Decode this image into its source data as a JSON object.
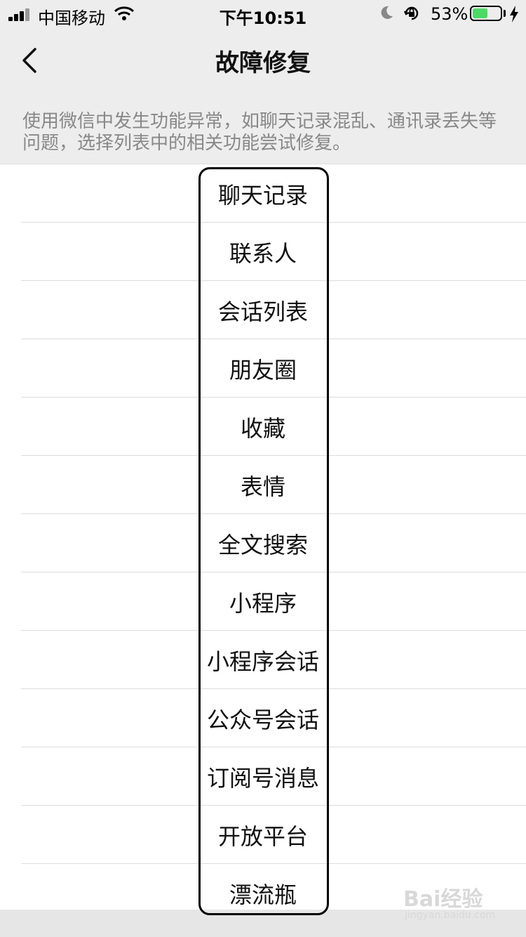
{
  "status_bar": {
    "carrier": "中国移动",
    "time": "下午10:51",
    "battery_percent": "53%",
    "battery_level": 0.53,
    "battery_color": "#4cd964"
  },
  "nav": {
    "title": "故障修复",
    "back_icon": "chevron-left-icon"
  },
  "description": "使用微信中发生功能异常，如聊天记录混乱、通讯录丢失等问题，选择列表中的相关功能尝试修复。",
  "items": [
    {
      "label": "聊天记录"
    },
    {
      "label": "联系人"
    },
    {
      "label": "会话列表"
    },
    {
      "label": "朋友圈"
    },
    {
      "label": "收藏"
    },
    {
      "label": "表情"
    },
    {
      "label": "全文搜索"
    },
    {
      "label": "小程序"
    },
    {
      "label": "小程序会话"
    },
    {
      "label": "公众号会话"
    },
    {
      "label": "订阅号消息"
    },
    {
      "label": "开放平台"
    },
    {
      "label": "漂流瓶"
    }
  ],
  "watermark": {
    "main": "Bai经验",
    "sub": "jingyan.baidu.com"
  }
}
